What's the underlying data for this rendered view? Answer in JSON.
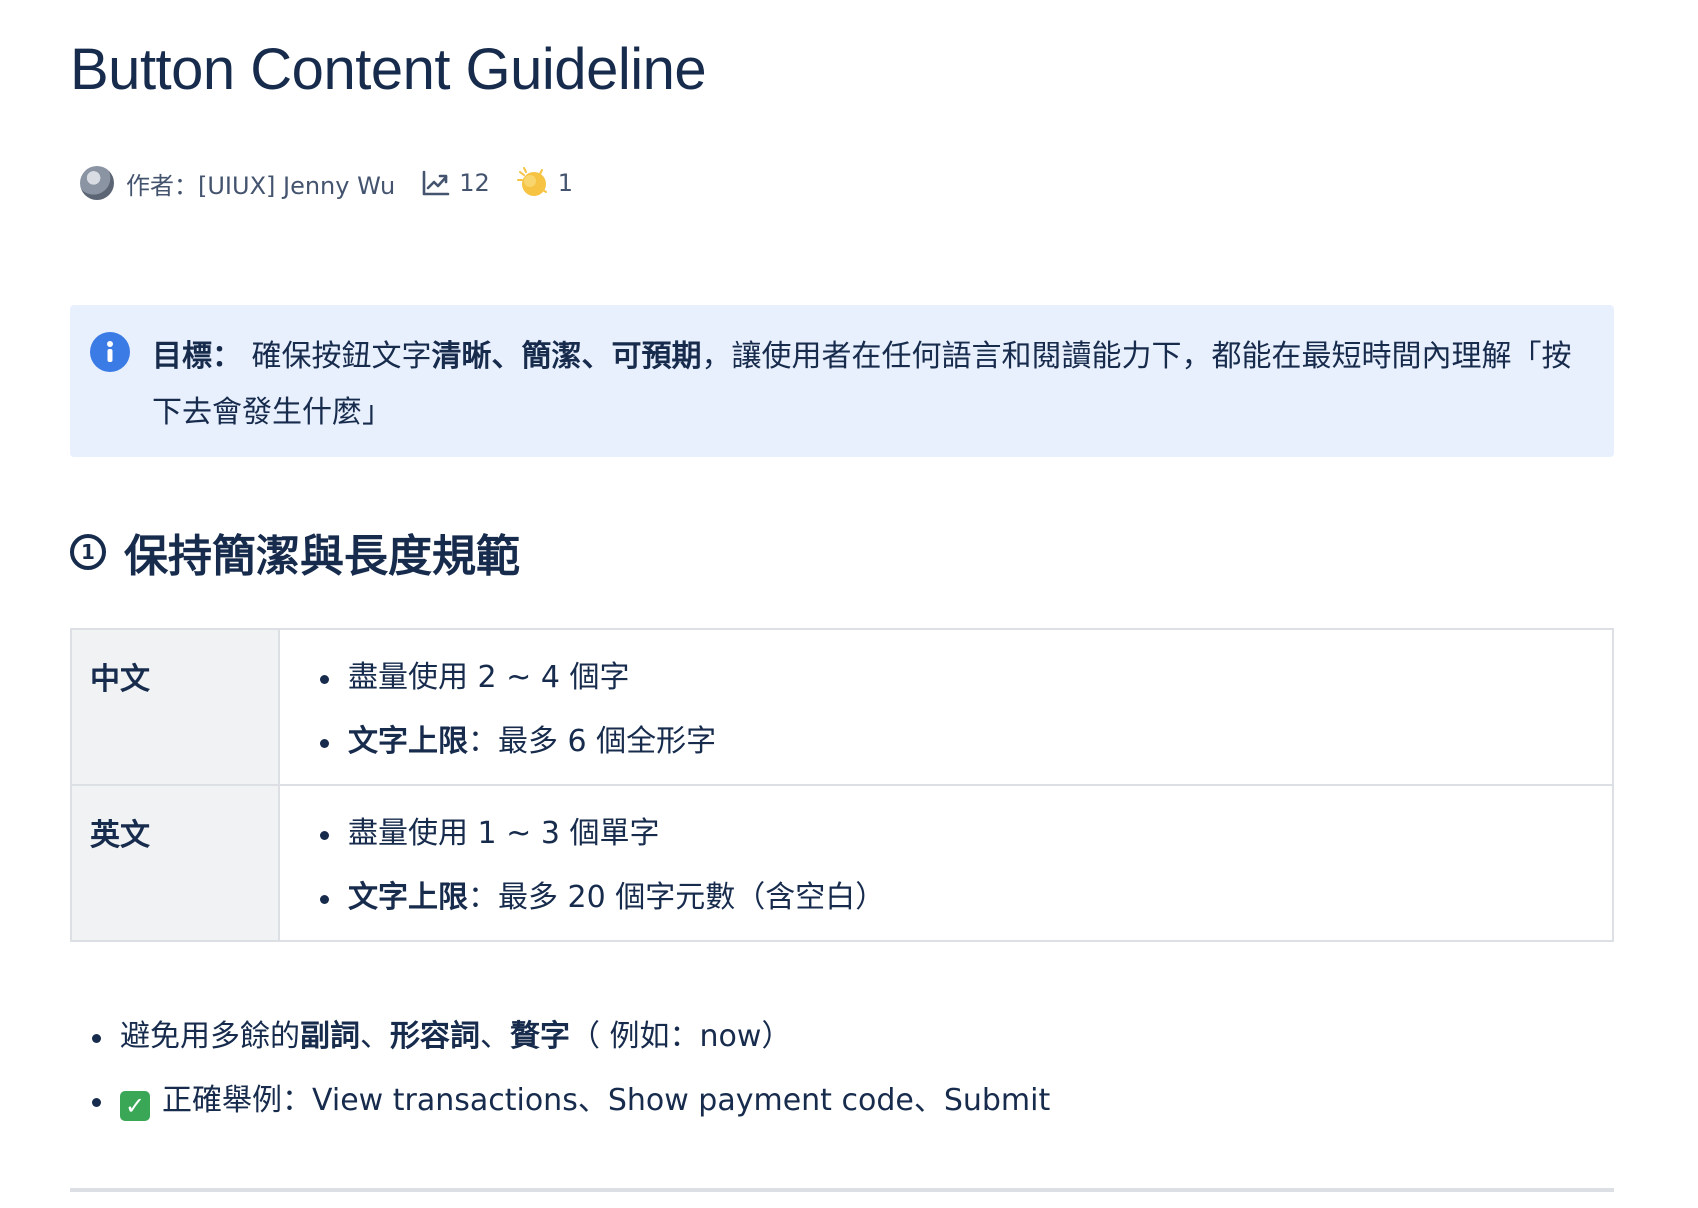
{
  "page": {
    "title": "Button Content Guideline"
  },
  "byline": {
    "author": "作者：[UIUX] Jenny Wu",
    "views": "12",
    "reactions": "1"
  },
  "callout": {
    "label": "目標：",
    "text_1": " 確保按鈕文字",
    "bold_1": "清晰、簡潔、可預期",
    "text_2": "，讓使用者在任何語言和閱讀能力下，都能在最短時間內理解「按下去會發生什麼」"
  },
  "section": {
    "number": "1",
    "heading": "保持簡潔與長度規範"
  },
  "table": {
    "rows": [
      {
        "head": "中文",
        "items": [
          {
            "plain": "盡量使用 2 ~ 4 個字"
          },
          {
            "bold": "文字上限",
            "rest": "：最多 6 個全形字"
          }
        ]
      },
      {
        "head": "英文",
        "items": [
          {
            "plain": "盡量使用 1 ~ 3 個單字"
          },
          {
            "bold": "文字上限",
            "rest": "：最多 20 個字元數（含空白）"
          }
        ]
      }
    ]
  },
  "bullets": {
    "avoid": {
      "text_1": "避免用多餘的",
      "bold_1": "副詞",
      "sep_1": "、",
      "bold_2": "形容詞",
      "sep_2": "、",
      "bold_3": "贅字",
      "text_2": "（ 例如：now）"
    },
    "good": {
      "text": "正確舉例：View transactions、Show payment code、Submit"
    }
  },
  "colors": {
    "callout_bg": "#e9f0fd",
    "info_icon": "#3b7be6",
    "check_icon": "#3aa757",
    "table_head_bg": "#f0f2f4",
    "text": "#172b4d"
  }
}
